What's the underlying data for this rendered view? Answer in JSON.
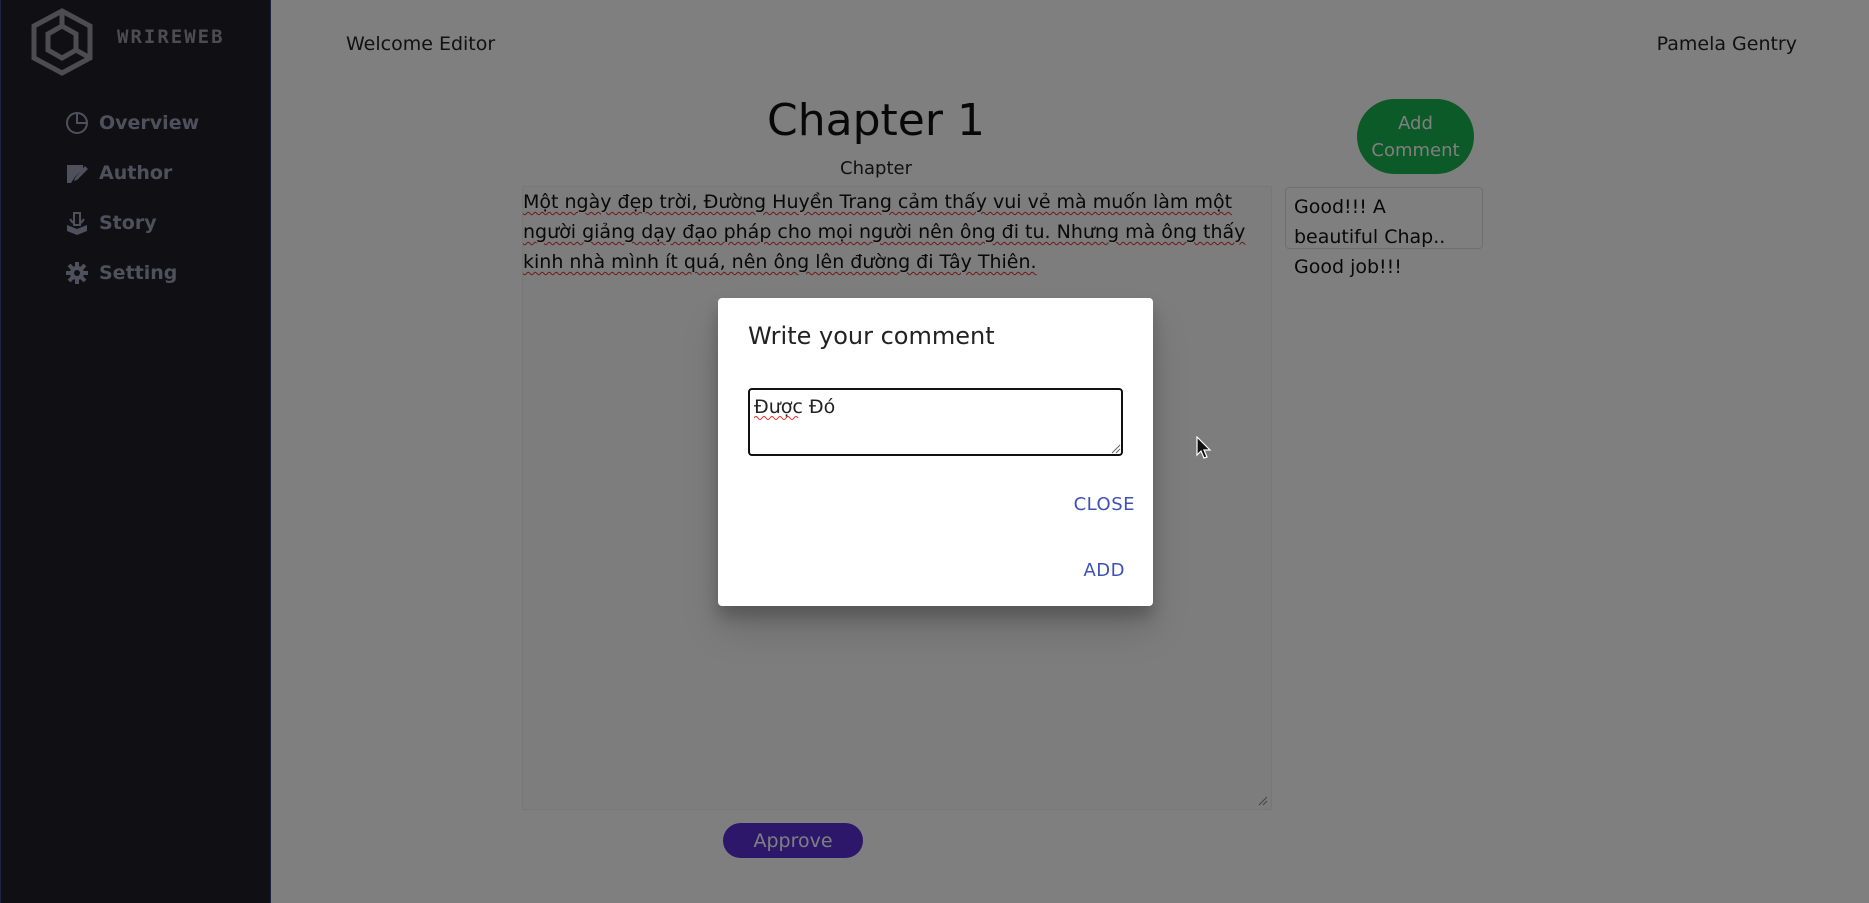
{
  "sidebar": {
    "logo_text": "WRIREWEB",
    "items": [
      {
        "label": "Overview",
        "icon": "pie-chart-icon"
      },
      {
        "label": "Author",
        "icon": "pen-icon"
      },
      {
        "label": "Story",
        "icon": "book-icon"
      },
      {
        "label": "Setting",
        "icon": "gear-icon"
      }
    ]
  },
  "header": {
    "welcome": "Welcome Editor",
    "username": "Pamela Gentry"
  },
  "main": {
    "chapter_title": "Chapter 1",
    "chapter_subtitle": "Chapter",
    "add_comment_label_1": "Add",
    "add_comment_label_2": "Comment",
    "content_text": "Một ngày đẹp trời, Đường Huyền Trang cảm thấy vui vẻ mà muốn làm một người giảng dạy đạo pháp cho mọi người nên ông đi tu. Nhưng mà ông thấy kinh nhà mình ít quá, nên ông lên đường đi Tây Thiên.",
    "existing_comment": "Good!!! A beautiful Chap.. Good job!!!",
    "approve_label": "Approve"
  },
  "dialog": {
    "title": "Write your comment",
    "input_value": "Được Đó",
    "close_label": "CLOSE",
    "add_label": "ADD"
  },
  "colors": {
    "sidebar_bg": "#1f1f29",
    "add_comment_bg": "#16b54f",
    "approve_bg": "#5a2fd6",
    "dialog_button": "#3f51b5"
  }
}
